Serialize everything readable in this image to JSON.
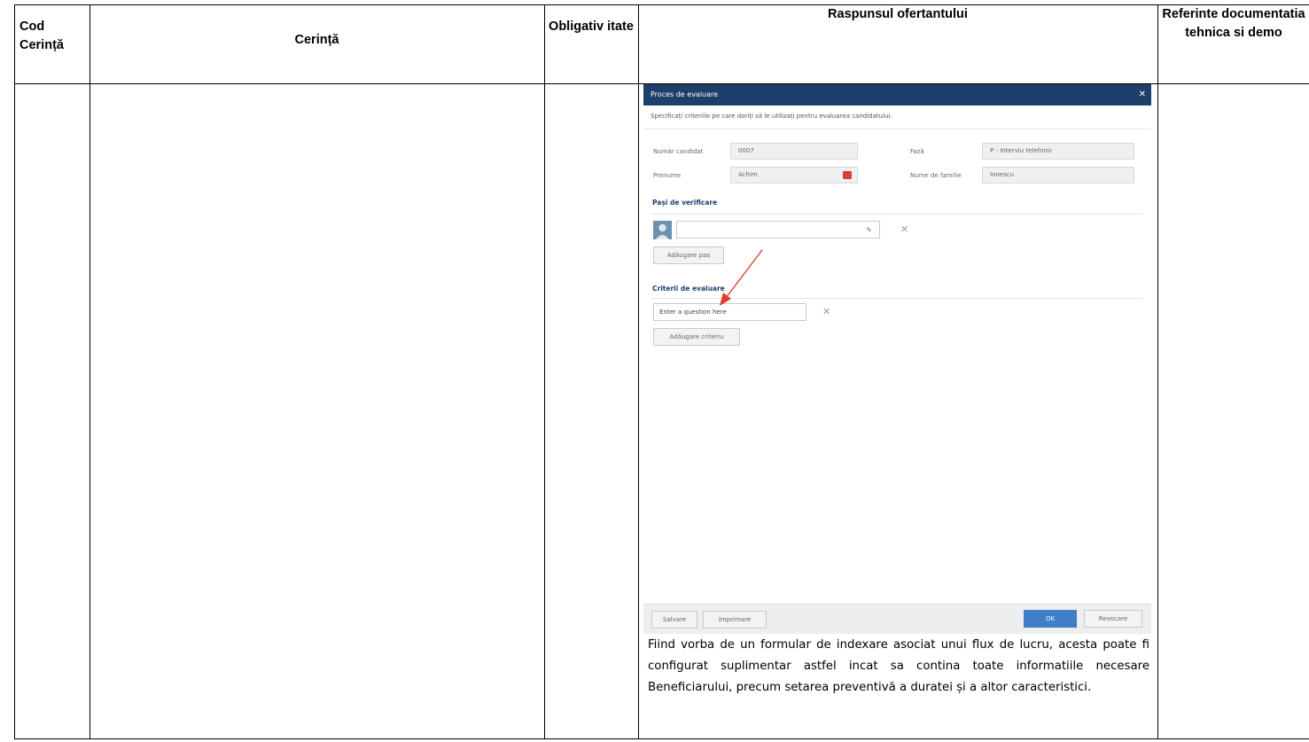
{
  "table": {
    "headers": {
      "code": "Cod Cerință",
      "requirement": "Cerință",
      "mandatory": "Obligativ itate",
      "response": "Raspunsul ofertantului",
      "references": "Referinte documentatia tehnica si demo"
    }
  },
  "screenshot": {
    "dialog_title": "Proces de evaluare",
    "description": "Specificați criteriile pe care doriți să le utilizați pentru evaluarea candidatului.",
    "fields": {
      "candidate_number_label": "Număr candidat",
      "candidate_number_value": "0007",
      "phase_label": "Fază",
      "phase_value": "P - Interviu telefonic",
      "first_name_label": "Prenume",
      "first_name_value": "Achim",
      "last_name_label": "Nume de familie",
      "last_name_value": "Ionescu"
    },
    "verification_section": "Pași de verificare",
    "add_step_button": "Adăugare pas",
    "criteria_section": "Criterii de evaluare",
    "question_placeholder": "Enter a question here",
    "add_criterion_button": "Adăugare criteriu",
    "footer": {
      "save": "Salvare",
      "print": "Imprimare",
      "ok": "OK",
      "cancel": "Revocare"
    }
  },
  "response_text": "Fiind vorba de un formular de indexare asociat unui flux de lucru, acesta poate fi configurat suplimentar astfel incat sa contina toate informatiile necesare Beneficiarului, precum setarea preventivă a duratei și a altor caracteristici."
}
